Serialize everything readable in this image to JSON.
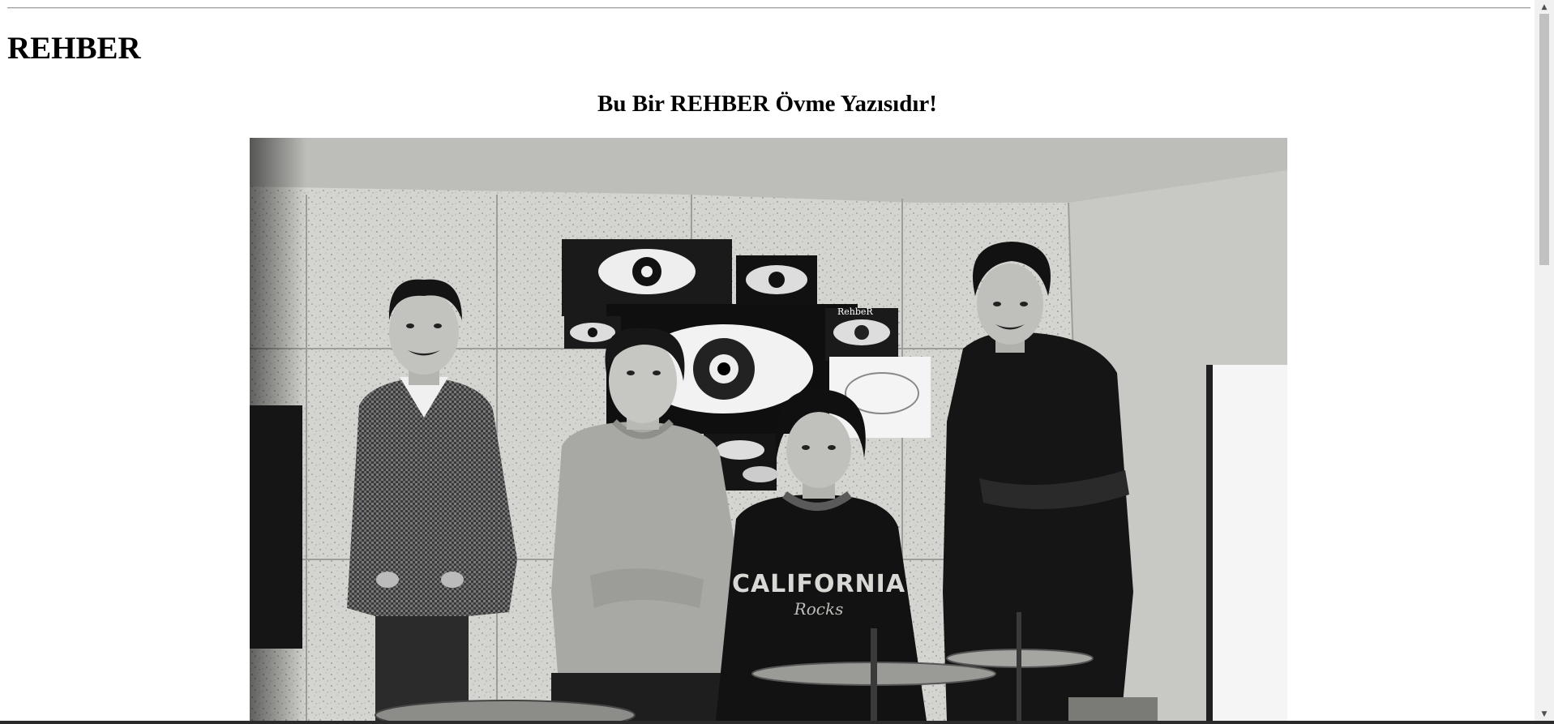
{
  "page": {
    "title": "REHBER",
    "subtitle": "Bu Bir REHBER Övme Yazısıdır!"
  },
  "photo": {
    "alt": "REHBER",
    "wall_sign": "RehbeR",
    "shirt_text": "CALIFORNIA",
    "shirt_subtext": "Rocks"
  },
  "scrollbar": {
    "up_icon": "▲",
    "down_icon": "▼",
    "position": 0
  }
}
